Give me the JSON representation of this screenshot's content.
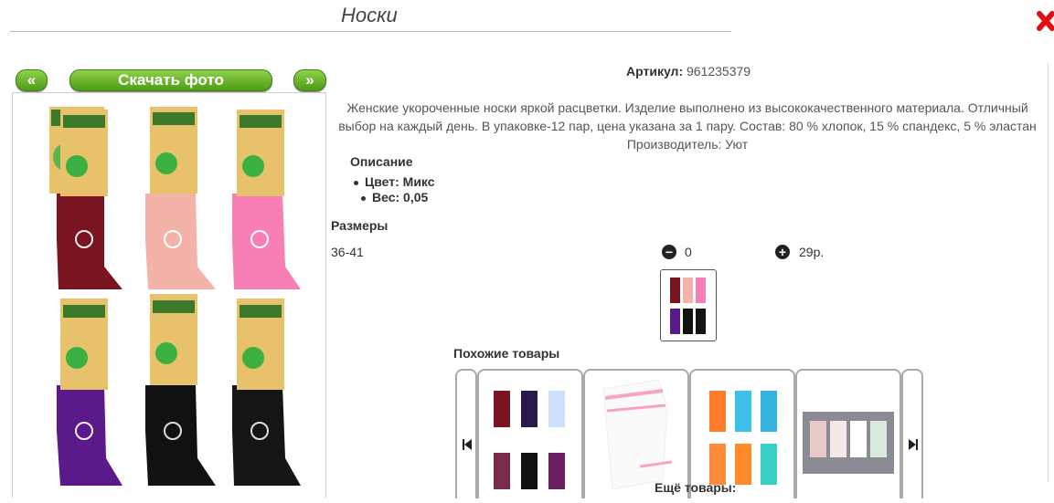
{
  "page": {
    "title": "Носки"
  },
  "gallery": {
    "prev_label": "«",
    "download_label": "Скачать фото",
    "next_label": "»"
  },
  "product": {
    "article_label": "Артикул:",
    "article_value": "961235379",
    "description_lines": [
      "Женские укороченные носки яркой расцветки. Изделие выполнено из высококачественного материала. Отличный",
      "выбор на каждый день. В упаковке-12 пар, цена указана за 1 пару. Состав: 80 % хлопок, 15 % спандекс, 5 % эластан",
      "Производитель: Уют"
    ],
    "specs_heading": "Описание",
    "specs": [
      "Цвет: Микс",
      "Вес: 0,05"
    ],
    "sizes_heading": "Размеры",
    "size": "36-41",
    "quantity": "0",
    "price": "29р."
  },
  "similar": {
    "heading": "Похожие товары",
    "more_label": "Ещё товары:"
  },
  "colors": {
    "button_green": "#5aa81f",
    "sock_colors": [
      "#7a1420",
      "#f4b3a8",
      "#f77fb5",
      "#5b1a8c",
      "#111111",
      "#151515"
    ]
  }
}
